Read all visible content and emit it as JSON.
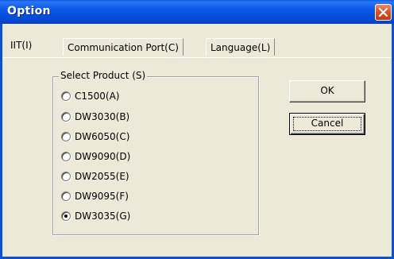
{
  "window": {
    "title": "Option"
  },
  "tabs": [
    {
      "label": "IIT(I)",
      "active": true
    },
    {
      "label": "Communication Port(C)",
      "active": false
    },
    {
      "label": "Language(L)",
      "active": false
    }
  ],
  "group": {
    "label": "Select Product (S)",
    "options": [
      {
        "label": "C1500(A)",
        "checked": false
      },
      {
        "label": "DW3030(B)",
        "checked": false
      },
      {
        "label": "DW6050(C)",
        "checked": false
      },
      {
        "label": "DW9090(D)",
        "checked": false
      },
      {
        "label": "DW2055(E)",
        "checked": false
      },
      {
        "label": "DW9095(F)",
        "checked": false
      },
      {
        "label": "DW3035(G)",
        "checked": true
      }
    ]
  },
  "buttons": {
    "ok_label": "OK",
    "cancel_label": "Cancel"
  },
  "colors": {
    "titlebar": "#0a58e8",
    "face": "#ece9d8",
    "close": "#d9532d"
  },
  "icons": {
    "close": "close-icon"
  }
}
